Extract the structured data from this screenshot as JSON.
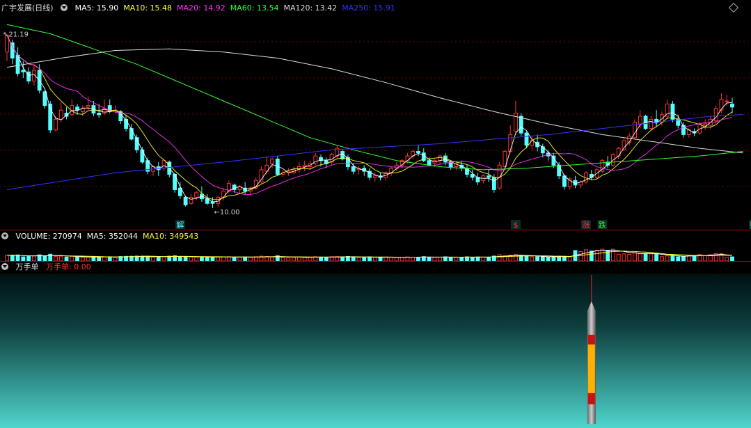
{
  "header": {
    "title": "广宇发展(日线)",
    "ma": [
      {
        "label": "MA5: 15.90",
        "color": "#ffffff"
      },
      {
        "label": "MA10: 15.48",
        "color": "#ffff33"
      },
      {
        "label": "MA20: 14.92",
        "color": "#ff33ff"
      },
      {
        "label": "MA60: 13.54",
        "color": "#33ff33"
      },
      {
        "label": "MA120: 13.42",
        "color": "#dddddd"
      },
      {
        "label": "MA250: 15.91",
        "color": "#3333ff"
      }
    ]
  },
  "volume_header": {
    "items": [
      {
        "label": "VOLUME: 270974",
        "color": "#ffffff"
      },
      {
        "label": "MA5: 352044",
        "color": "#ffffff"
      },
      {
        "label": "MA10: 349543",
        "color": "#ffff33"
      }
    ]
  },
  "indicator_header": {
    "name": "万手单",
    "value_label": "万手单: 0.00",
    "value_color": "#ff3333"
  },
  "colors": {
    "up": "#ff3333",
    "down": "#55ffff",
    "grid": "#7a0000",
    "bg": "#000000"
  },
  "chart_data": {
    "type": "candlestick",
    "high_annotation": "21.19",
    "low_annotation": "10.00",
    "ylim": [
      9.2,
      22.4
    ],
    "candles": [
      [
        20.0,
        21.19,
        21.1,
        19.4
      ],
      [
        20.6,
        20.8,
        19.6,
        19.2
      ],
      [
        19.8,
        20.3,
        18.6,
        18.4
      ],
      [
        18.8,
        19.4,
        18.7,
        18.3
      ],
      [
        18.7,
        19.0,
        18.1,
        17.9
      ],
      [
        18.1,
        19.2,
        18.8,
        17.8
      ],
      [
        18.8,
        19.2,
        17.5,
        17.3
      ],
      [
        17.4,
        17.5,
        16.5,
        16.3
      ],
      [
        16.6,
        16.8,
        14.9,
        14.7
      ],
      [
        14.9,
        15.8,
        15.6,
        14.8
      ],
      [
        15.6,
        16.7,
        16.2,
        15.4
      ],
      [
        16.0,
        16.4,
        15.8,
        15.6
      ],
      [
        15.9,
        16.9,
        16.5,
        15.8
      ],
      [
        16.4,
        16.6,
        16.2,
        15.9
      ],
      [
        16.1,
        16.5,
        16.3,
        15.8
      ],
      [
        16.4,
        17.1,
        16.5,
        16.2
      ],
      [
        16.5,
        16.8,
        16.0,
        15.8
      ],
      [
        16.0,
        16.6,
        15.9,
        15.7
      ],
      [
        16.0,
        16.9,
        16.3,
        15.9
      ],
      [
        16.5,
        16.9,
        16.1,
        16.0
      ],
      [
        16.2,
        16.5,
        16.2,
        16.0
      ],
      [
        16.1,
        16.2,
        15.5,
        15.3
      ],
      [
        15.6,
        15.9,
        15.0,
        14.8
      ],
      [
        15.0,
        15.3,
        14.3,
        14.2
      ],
      [
        14.4,
        14.6,
        13.6,
        13.4
      ],
      [
        13.6,
        13.8,
        12.8,
        12.7
      ],
      [
        12.9,
        13.1,
        12.2,
        12.0
      ],
      [
        12.2,
        12.6,
        12.5,
        11.9
      ],
      [
        12.5,
        12.8,
        12.3,
        11.9
      ],
      [
        12.4,
        13.0,
        12.9,
        12.2
      ],
      [
        12.8,
        12.9,
        12.0,
        11.8
      ],
      [
        12.0,
        12.1,
        11.0,
        10.8
      ],
      [
        11.1,
        11.5,
        10.6,
        10.4
      ],
      [
        10.5,
        10.6,
        10.0,
        9.9
      ],
      [
        10.1,
        10.7,
        10.5,
        10.0
      ],
      [
        10.5,
        10.9,
        10.8,
        10.3
      ],
      [
        10.7,
        11.2,
        10.4,
        10.2
      ],
      [
        10.4,
        10.7,
        10.1,
        10.0
      ],
      [
        10.2,
        10.5,
        10.1,
        9.8
      ],
      [
        10.1,
        10.6,
        10.5,
        9.9
      ],
      [
        10.5,
        11.1,
        10.9,
        10.3
      ],
      [
        10.9,
        11.6,
        11.4,
        10.8
      ],
      [
        11.3,
        11.4,
        11.0,
        10.8
      ],
      [
        11.0,
        11.3,
        11.2,
        10.7
      ],
      [
        11.1,
        11.5,
        10.9,
        10.7
      ],
      [
        10.9,
        11.2,
        11.1,
        10.7
      ],
      [
        11.1,
        11.8,
        11.6,
        11.0
      ],
      [
        11.5,
        12.5,
        12.3,
        11.4
      ],
      [
        12.2,
        13.2,
        12.6,
        12.0
      ],
      [
        12.7,
        13.1,
        13.0,
        12.4
      ],
      [
        13.0,
        13.2,
        12.0,
        11.9
      ],
      [
        12.0,
        12.3,
        12.1,
        11.8
      ],
      [
        12.1,
        12.4,
        12.2,
        11.9
      ],
      [
        12.1,
        12.5,
        12.3,
        12.0
      ],
      [
        12.3,
        12.8,
        12.5,
        12.1
      ],
      [
        12.5,
        12.9,
        12.6,
        12.2
      ],
      [
        12.5,
        12.9,
        12.7,
        12.3
      ],
      [
        12.7,
        13.4,
        13.2,
        12.6
      ],
      [
        13.1,
        13.3,
        12.9,
        12.5
      ],
      [
        12.9,
        13.1,
        12.7,
        12.4
      ],
      [
        12.8,
        13.4,
        13.3,
        12.6
      ],
      [
        13.2,
        13.9,
        13.7,
        13.0
      ],
      [
        13.5,
        13.6,
        13.0,
        12.9
      ],
      [
        13.1,
        13.3,
        12.5,
        12.3
      ],
      [
        12.5,
        12.7,
        12.2,
        12.0
      ],
      [
        12.3,
        12.5,
        12.4,
        12.0
      ],
      [
        12.4,
        12.6,
        12.2,
        11.9
      ],
      [
        12.2,
        12.4,
        11.8,
        11.6
      ],
      [
        11.8,
        12.1,
        11.9,
        11.5
      ],
      [
        11.9,
        12.1,
        11.8,
        11.6
      ],
      [
        11.8,
        12.2,
        12.1,
        11.6
      ],
      [
        12.1,
        12.5,
        12.4,
        11.9
      ],
      [
        12.4,
        12.8,
        12.6,
        12.2
      ],
      [
        12.6,
        13.0,
        12.9,
        12.4
      ],
      [
        12.8,
        13.4,
        13.2,
        12.7
      ],
      [
        13.2,
        13.6,
        13.5,
        13.0
      ],
      [
        13.5,
        13.9,
        13.4,
        13.2
      ],
      [
        13.4,
        13.7,
        12.9,
        12.8
      ],
      [
        12.9,
        13.1,
        12.6,
        12.5
      ],
      [
        12.7,
        13.0,
        12.9,
        12.5
      ],
      [
        12.9,
        13.3,
        13.2,
        12.7
      ],
      [
        13.2,
        13.4,
        12.8,
        12.6
      ],
      [
        12.8,
        12.9,
        12.5,
        12.3
      ],
      [
        12.5,
        12.8,
        12.7,
        12.3
      ],
      [
        12.6,
        12.9,
        12.4,
        12.2
      ],
      [
        12.4,
        12.6,
        12.0,
        11.8
      ],
      [
        12.0,
        12.3,
        11.8,
        11.6
      ],
      [
        11.8,
        12.1,
        11.5,
        11.3
      ],
      [
        11.6,
        12.0,
        11.9,
        11.4
      ],
      [
        11.9,
        12.3,
        11.8,
        11.5
      ],
      [
        11.8,
        12.0,
        11.0,
        10.8
      ],
      [
        11.1,
        12.8,
        12.6,
        11.0
      ],
      [
        12.5,
        13.6,
        13.5,
        12.3
      ],
      [
        13.5,
        15.2,
        14.6,
        13.4
      ],
      [
        14.8,
        16.8,
        16.0,
        14.6
      ],
      [
        15.8,
        16.0,
        14.7,
        14.5
      ],
      [
        14.7,
        14.8,
        13.9,
        13.7
      ],
      [
        13.9,
        14.5,
        14.2,
        13.6
      ],
      [
        14.1,
        14.6,
        13.8,
        13.5
      ],
      [
        13.8,
        14.0,
        13.4,
        13.1
      ],
      [
        13.4,
        13.6,
        13.2,
        12.9
      ],
      [
        13.2,
        13.4,
        12.6,
        12.4
      ],
      [
        12.6,
        12.8,
        11.9,
        11.7
      ],
      [
        11.9,
        12.0,
        11.2,
        11.0
      ],
      [
        11.2,
        11.8,
        11.7,
        11.0
      ],
      [
        11.6,
        11.9,
        11.3,
        11.1
      ],
      [
        11.3,
        11.6,
        11.5,
        11.1
      ],
      [
        11.5,
        12.2,
        12.1,
        11.4
      ],
      [
        12.0,
        12.3,
        11.8,
        11.6
      ],
      [
        11.8,
        12.4,
        12.3,
        11.7
      ],
      [
        12.2,
        13.0,
        12.9,
        12.1
      ],
      [
        12.8,
        13.2,
        12.6,
        12.4
      ],
      [
        12.6,
        13.4,
        13.3,
        12.5
      ],
      [
        13.2,
        13.8,
        13.7,
        13.0
      ],
      [
        13.6,
        14.4,
        14.2,
        13.5
      ],
      [
        14.1,
        14.7,
        14.5,
        13.9
      ],
      [
        14.4,
        15.6,
        15.4,
        14.3
      ],
      [
        15.3,
        16.2,
        15.8,
        15.0
      ],
      [
        15.8,
        15.9,
        15.0,
        14.9
      ],
      [
        15.0,
        15.8,
        15.6,
        14.9
      ],
      [
        15.6,
        16.2,
        15.4,
        15.1
      ],
      [
        15.4,
        16.1,
        15.9,
        15.2
      ],
      [
        15.8,
        16.9,
        16.6,
        15.6
      ],
      [
        16.6,
        16.8,
        15.6,
        15.4
      ],
      [
        15.6,
        15.9,
        15.2,
        15.0
      ],
      [
        15.2,
        15.4,
        14.6,
        14.4
      ],
      [
        14.6,
        15.0,
        14.9,
        14.4
      ],
      [
        14.8,
        15.0,
        14.7,
        14.5
      ],
      [
        14.7,
        15.4,
        15.3,
        14.6
      ],
      [
        15.2,
        15.6,
        15.3,
        14.9
      ],
      [
        15.2,
        15.8,
        15.6,
        15.0
      ],
      [
        15.5,
        16.5,
        16.3,
        15.3
      ],
      [
        16.2,
        17.3,
        16.9,
        16.0
      ],
      [
        16.8,
        17.2,
        16.8,
        16.5
      ],
      [
        16.6,
        17.0,
        16.4,
        16.0
      ]
    ],
    "ma_series": [
      {
        "name": "MA5",
        "color": "#ffffff",
        "k": 3
      },
      {
        "name": "MA10",
        "color": "#ffff33",
        "k": 7
      },
      {
        "name": "MA20",
        "color": "#ff33ff",
        "k": 14
      }
    ],
    "long_ma": [
      {
        "name": "MA60",
        "color": "#33ff33",
        "points": [
          [
            0,
            21.8
          ],
          [
            8,
            21.2
          ],
          [
            16,
            20.2
          ],
          [
            24,
            19.2
          ],
          [
            32,
            18.0
          ],
          [
            40,
            16.8
          ],
          [
            48,
            15.6
          ],
          [
            56,
            14.4
          ],
          [
            64,
            13.6
          ],
          [
            72,
            12.9
          ],
          [
            80,
            12.5
          ],
          [
            88,
            12.3
          ],
          [
            96,
            12.4
          ],
          [
            104,
            12.6
          ],
          [
            112,
            12.8
          ],
          [
            120,
            13.0
          ],
          [
            128,
            13.2
          ],
          [
            136,
            13.5
          ]
        ]
      },
      {
        "name": "MA120",
        "color": "#dddddd",
        "points": [
          [
            0,
            19.0
          ],
          [
            10,
            19.6
          ],
          [
            20,
            20.1
          ],
          [
            30,
            20.2
          ],
          [
            40,
            20.0
          ],
          [
            50,
            19.6
          ],
          [
            60,
            18.9
          ],
          [
            70,
            18.0
          ],
          [
            80,
            17.0
          ],
          [
            90,
            16.1
          ],
          [
            100,
            15.3
          ],
          [
            110,
            14.6
          ],
          [
            120,
            14.1
          ],
          [
            128,
            13.7
          ],
          [
            136,
            13.4
          ]
        ]
      },
      {
        "name": "MA250",
        "color": "#3333ff",
        "points": [
          [
            0,
            11.0
          ],
          [
            20,
            12.1
          ],
          [
            40,
            12.8
          ],
          [
            60,
            13.6
          ],
          [
            80,
            14.0
          ],
          [
            100,
            14.6
          ],
          [
            110,
            15.0
          ],
          [
            120,
            15.4
          ],
          [
            130,
            15.8
          ],
          [
            136,
            15.91
          ]
        ]
      }
    ],
    "event_markers": [
      {
        "index": 32,
        "label": "解",
        "color": "#55ffff"
      },
      {
        "index": 94,
        "label": "$",
        "color": "#ff3333"
      },
      {
        "index": 107,
        "label": "涨",
        "color": "#ff3333"
      },
      {
        "index": 110,
        "label": "跌",
        "color": "#33ff33"
      },
      {
        "index": 138,
        "label": "财",
        "color": "#55ffff"
      }
    ],
    "volume": {
      "ylim": [
        0,
        1800000
      ],
      "ma5_value": 352044,
      "ma10_value": 349543
    },
    "indicator": {
      "signal_index": 108,
      "value": 0.0
    }
  }
}
